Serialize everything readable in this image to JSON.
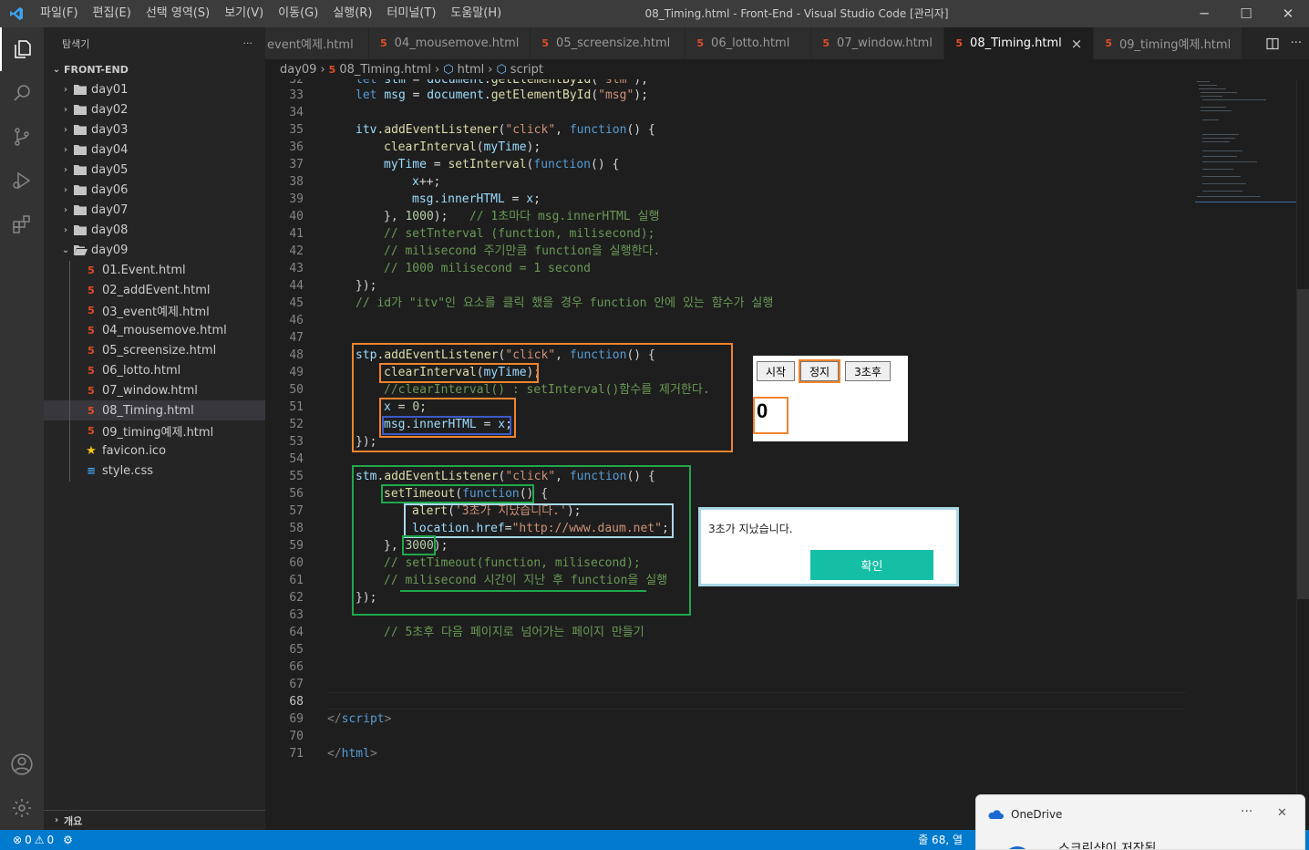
{
  "window": {
    "title": "08_Timing.html - Front-End - Visual Studio Code [관리자]",
    "menu": [
      "파일(F)",
      "편집(E)",
      "선택 영역(S)",
      "보기(V)",
      "이동(G)",
      "실행(R)",
      "터미널(T)",
      "도움말(H)"
    ]
  },
  "sidebar": {
    "header": "탐색기",
    "more": "···",
    "root": "FRONT-END",
    "folders": [
      "day01",
      "day02",
      "day03",
      "day04",
      "day05",
      "day06",
      "day07",
      "day08",
      "day09"
    ],
    "files": [
      {
        "name": "01.Event.html",
        "icon": "html-icon"
      },
      {
        "name": "02_addEvent.html",
        "icon": "html-icon"
      },
      {
        "name": "03_event예제.html",
        "icon": "html-icon"
      },
      {
        "name": "04_mousemove.html",
        "icon": "html-icon"
      },
      {
        "name": "05_screensize.html",
        "icon": "html-icon"
      },
      {
        "name": "06_lotto.html",
        "icon": "html-icon"
      },
      {
        "name": "07_window.html",
        "icon": "html-icon"
      },
      {
        "name": "08_Timing.html",
        "icon": "html-icon"
      },
      {
        "name": "09_timing예제.html",
        "icon": "html-icon"
      },
      {
        "name": "favicon.ico",
        "icon": "star-icon"
      },
      {
        "name": "style.css",
        "icon": "css-icon"
      }
    ],
    "outline": "개요"
  },
  "tabs": [
    {
      "label": "event예제.html"
    },
    {
      "label": "04_mousemove.html"
    },
    {
      "label": "05_screensize.html"
    },
    {
      "label": "06_lotto.html"
    },
    {
      "label": "07_window.html"
    },
    {
      "label": "08_Timing.html"
    },
    {
      "label": "09_timing예제.html"
    }
  ],
  "tab_close": "×",
  "breadcrumb": {
    "folder": "day09",
    "file": "08_Timing.html",
    "node1": "html",
    "node2": "script"
  },
  "editor": {
    "current_line": "68",
    "lines": [
      {
        "n": "33",
        "html": "<span class='kw'>let</span> <span class='var'>msg</span> = <span class='var'>document</span>.<span class='fn'>getElementById</span>(<span class='str'>\"msg\"</span>);",
        "indent": 1
      },
      {
        "n": "34",
        "html": "",
        "indent": 0
      },
      {
        "n": "35",
        "html": "<span class='var'>itv</span>.<span class='fn'>addEventListener</span>(<span class='str'>\"click\"</span>, <span class='kw'>function</span>() {",
        "indent": 1
      },
      {
        "n": "36",
        "html": "<span class='fn'>clearInterval</span>(<span class='var'>myTime</span>);",
        "indent": 2
      },
      {
        "n": "37",
        "html": "<span class='var'>myTime</span> = <span class='fn'>setInterval</span>(<span class='kw'>function</span>() {",
        "indent": 2
      },
      {
        "n": "38",
        "html": "<span class='var'>x</span>++;",
        "indent": 3
      },
      {
        "n": "39",
        "html": "<span class='var'>msg</span>.<span class='var'>innerHTML</span> = <span class='var'>x</span>;",
        "indent": 3
      },
      {
        "n": "40",
        "html": "}, <span class='num'>1000</span>);   <span class='cm'>// 1초마다 msg.innerHTML 실행</span>",
        "indent": 2
      },
      {
        "n": "41",
        "html": "<span class='cm'>// setTnterval (function, milisecond);</span>",
        "indent": 2
      },
      {
        "n": "42",
        "html": "<span class='cm'>// milisecond 주기만큼 function을 실행한다.</span>",
        "indent": 2
      },
      {
        "n": "43",
        "html": "<span class='cm'>// 1000 milisecond = 1 second</span>",
        "indent": 2
      },
      {
        "n": "44",
        "html": "});",
        "indent": 1
      },
      {
        "n": "45",
        "html": "<span class='cm'>// id가 \"itv\"인 요소를 클릭 했을 경우 function 안에 있는 함수가 실행</span>",
        "indent": 1
      },
      {
        "n": "46",
        "html": "",
        "indent": 0
      },
      {
        "n": "47",
        "html": "",
        "indent": 0
      },
      {
        "n": "48",
        "html": "<span class='var'>stp</span>.<span class='fn'>addEventListener</span>(<span class='str'>\"click\"</span>, <span class='kw'>function</span>() {",
        "indent": 1
      },
      {
        "n": "49",
        "html": "<span class='fn'>clearInterval</span>(<span class='var'>myTime</span>);",
        "indent": 2
      },
      {
        "n": "50",
        "html": "<span class='cm'>//clearInterval() : setInterval()함수를 제거한다.</span>",
        "indent": 2
      },
      {
        "n": "51",
        "html": "<span class='var'>x</span> = <span class='num'>0</span>;",
        "indent": 2
      },
      {
        "n": "52",
        "html": "<span class='var'>msg</span>.<span class='var'>innerHTML</span> = <span class='var'>x</span>;",
        "indent": 2
      },
      {
        "n": "53",
        "html": "});",
        "indent": 1
      },
      {
        "n": "54",
        "html": "",
        "indent": 0
      },
      {
        "n": "55",
        "html": "<span class='var'>stm</span>.<span class='fn'>addEventListener</span>(<span class='str'>\"click\"</span>, <span class='kw'>function</span>() {",
        "indent": 1
      },
      {
        "n": "56",
        "html": "<span class='fn'>setTimeout</span>(<span class='kw'>function</span>() {",
        "indent": 2
      },
      {
        "n": "57",
        "html": "<span class='fn'>alert</span>(<span class='str'>'3초가 지났습니다.'</span>);",
        "indent": 3
      },
      {
        "n": "58",
        "html": "<span class='var'>location</span>.<span class='var'>href</span>=<span class='str'>\"http://www.daum.net\"</span>;",
        "indent": 3
      },
      {
        "n": "59",
        "html": "}, <span class='num'>3000</span>);",
        "indent": 2
      },
      {
        "n": "60",
        "html": "<span class='cm'>// setTimeout(function, milisecond);</span>",
        "indent": 2
      },
      {
        "n": "61",
        "html": "<span class='cm'>// milisecond 시간이 지난 후 function을 실행</span>",
        "indent": 2
      },
      {
        "n": "62",
        "html": "});",
        "indent": 1
      },
      {
        "n": "63",
        "html": "",
        "indent": 0
      },
      {
        "n": "64",
        "html": "<span class='cm'>// 5초후 다음 페이지로 넘어가는 페이지 만들기</span>",
        "indent": 2
      },
      {
        "n": "65",
        "html": "",
        "indent": 0
      },
      {
        "n": "66",
        "html": "",
        "indent": 0
      },
      {
        "n": "67",
        "html": "",
        "indent": 0
      },
      {
        "n": "68",
        "html": "",
        "indent": 0
      },
      {
        "n": "69",
        "html": "<span class='punct'>&lt;/</span><span class='tag'>script</span><span class='punct'>&gt;</span>",
        "indent": 0
      },
      {
        "n": "70",
        "html": "",
        "indent": 0
      },
      {
        "n": "71",
        "html": "<span class='punct'>&lt;/</span><span class='tag'>html</span><span class='punct'>&gt;</span>",
        "indent": 0
      }
    ]
  },
  "preview": {
    "buttons": [
      "시작",
      "정지",
      "3초후"
    ],
    "output": "0"
  },
  "alert": {
    "message": "3초가 지났습니다.",
    "ok": "확인"
  },
  "status": {
    "errors": "0",
    "warnings": "0",
    "position": "줄 68, 열"
  },
  "toast": {
    "app": "OneDrive",
    "more": "···",
    "close": "✕",
    "body": "스크린샷이 저장됨"
  },
  "colors": {
    "accent": "#007acc",
    "annot_orange": "#f0842c",
    "annot_green": "#1fa84a",
    "annot_blue": "#3c5ac8",
    "annot_lightblue": "#a8d8e8",
    "ok_button": "#14bfa5"
  }
}
